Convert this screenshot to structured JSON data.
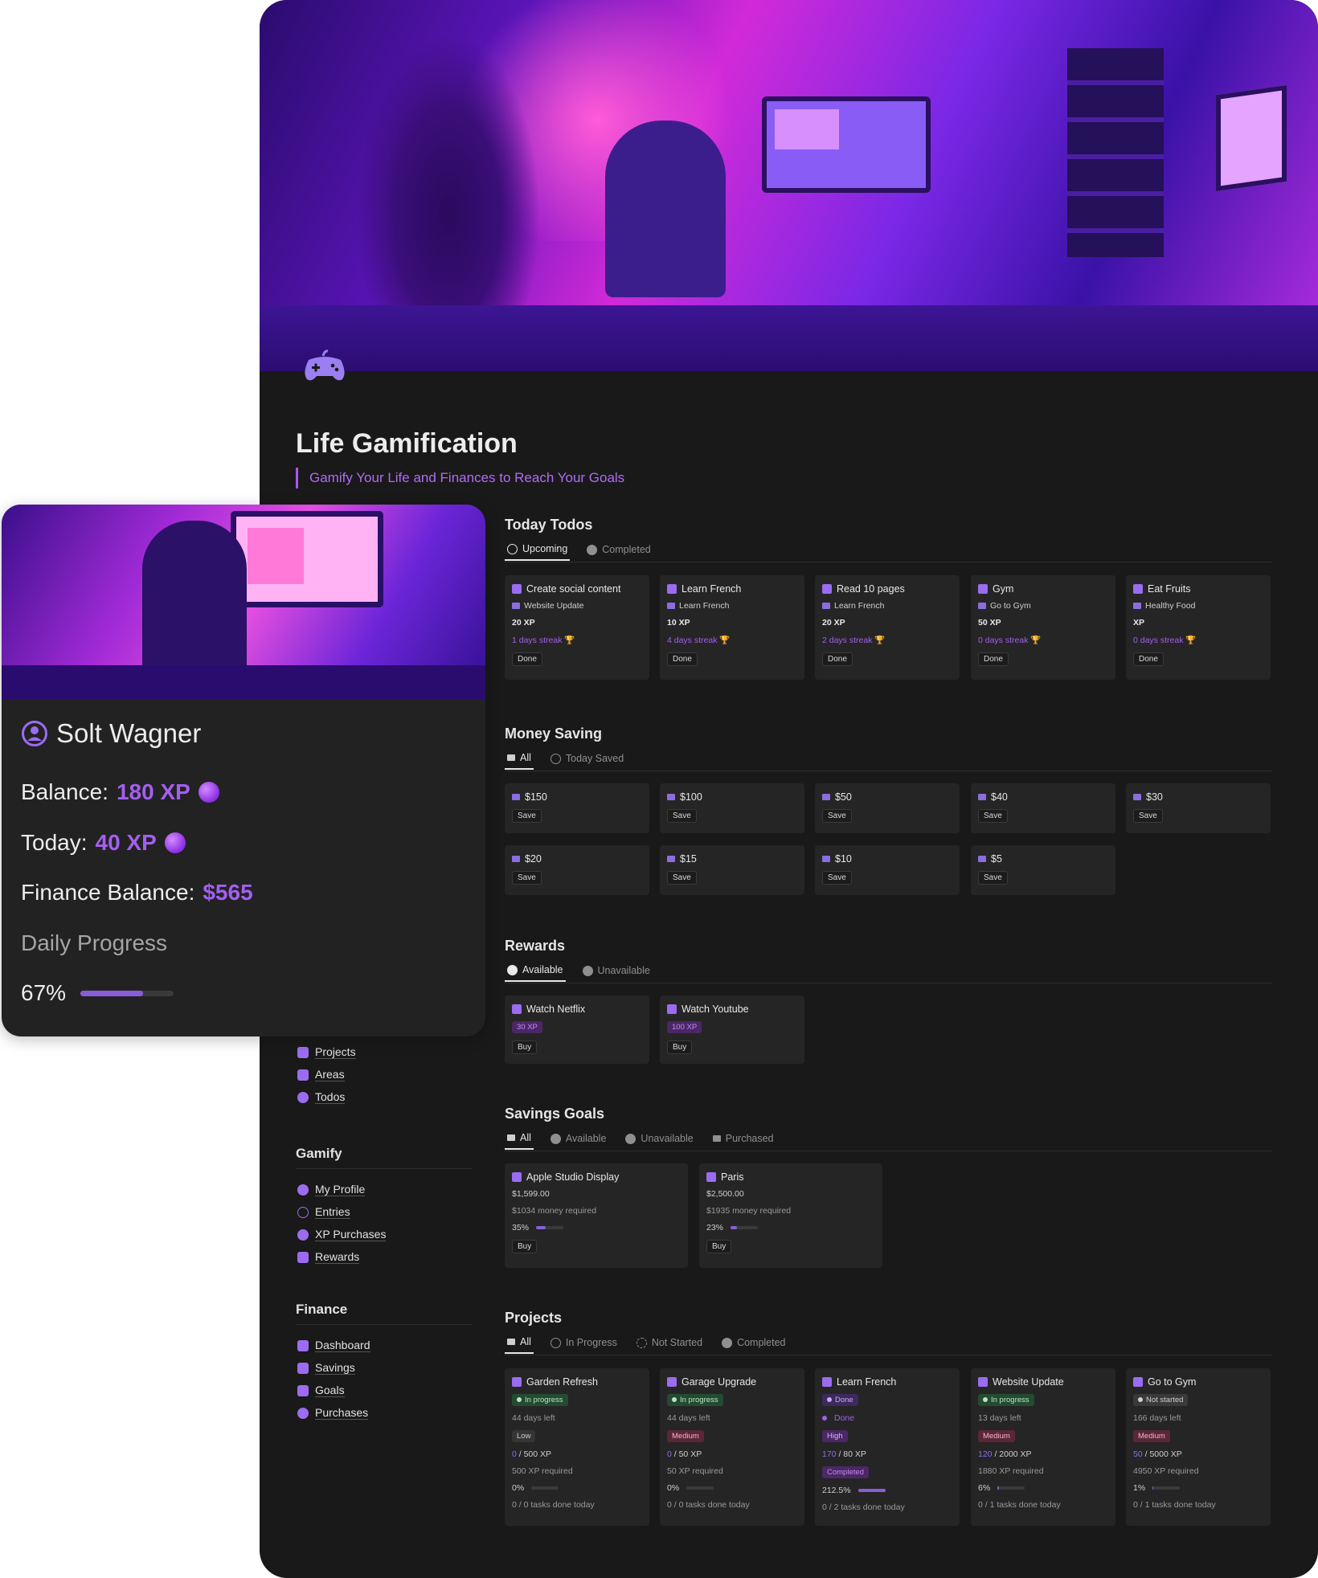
{
  "page": {
    "title": "Life Gamification",
    "subtitle": "Gamify Your Life and Finances to Reach Your Goals",
    "icon": "gamepad-icon"
  },
  "profile": {
    "name": "Solt Wagner",
    "balance_label": "Balance:",
    "balance_value": "180 XP",
    "today_label": "Today:",
    "today_value": "40 XP",
    "finance_label": "Finance Balance:",
    "finance_value": "$565",
    "daily_label": "Daily Progress",
    "daily_value": "67%",
    "daily_fraction": 0.67
  },
  "todos": {
    "title": "Today Todos",
    "tabs": [
      "Upcoming",
      "Completed"
    ],
    "items": [
      {
        "name": "Create social content",
        "project": "Website Update",
        "xp": "20 XP",
        "streak": "1 days streak 🏆",
        "button": "Done"
      },
      {
        "name": "Learn French",
        "project": "Learn French",
        "xp": "10 XP",
        "streak": "4 days streak 🏆",
        "button": "Done"
      },
      {
        "name": "Read 10 pages",
        "project": "Learn French",
        "xp": "20 XP",
        "streak": "2 days streak 🏆",
        "button": "Done"
      },
      {
        "name": "Gym",
        "project": "Go to Gym",
        "xp": "50 XP",
        "streak": "0 days streak 🏆",
        "button": "Done"
      },
      {
        "name": "Eat Fruits",
        "project": "Healthy Food",
        "xp": "XP",
        "streak": "0 days streak 🏆",
        "button": "Done"
      }
    ]
  },
  "saving": {
    "title": "Money Saving",
    "tabs": [
      "All",
      "Today Saved"
    ],
    "items": [
      {
        "amount": "$150",
        "button": "Save"
      },
      {
        "amount": "$100",
        "button": "Save"
      },
      {
        "amount": "$50",
        "button": "Save"
      },
      {
        "amount": "$40",
        "button": "Save"
      },
      {
        "amount": "$30",
        "button": "Save"
      },
      {
        "amount": "$20",
        "button": "Save"
      },
      {
        "amount": "$15",
        "button": "Save"
      },
      {
        "amount": "$10",
        "button": "Save"
      },
      {
        "amount": "$5",
        "button": "Save"
      }
    ]
  },
  "rewards": {
    "title": "Rewards",
    "tabs": [
      "Available",
      "Unavailable"
    ],
    "items": [
      {
        "name": "Watch Netflix",
        "xp": "30 XP",
        "button": "Buy"
      },
      {
        "name": "Watch Youtube",
        "xp": "100 XP",
        "button": "Buy"
      }
    ]
  },
  "goals": {
    "title": "Savings Goals",
    "tabs": [
      "All",
      "Available",
      "Unavailable",
      "Purchased"
    ],
    "items": [
      {
        "name": "Apple Studio Display",
        "price": "$1,599.00",
        "required": "$1034 money required",
        "pct": "35%",
        "fraction": 0.35,
        "button": "Buy"
      },
      {
        "name": "Paris",
        "price": "$2,500.00",
        "required": "$1935 money required",
        "pct": "23%",
        "fraction": 0.23,
        "button": "Buy"
      }
    ]
  },
  "projects": {
    "title": "Projects",
    "tabs": [
      "All",
      "In Progress",
      "Not Started",
      "Completed"
    ],
    "items": [
      {
        "name": "Garden Refresh",
        "status": "In progress",
        "days": "44 days left",
        "priority": "Low",
        "xp_cur": "0",
        "xp_total": " / 500 XP",
        "xp_req": "500 XP required",
        "pct": "0%",
        "fraction": 0.0,
        "tasks": "0 / 0 tasks done today"
      },
      {
        "name": "Garage Upgrade",
        "status": "In progress",
        "days": "44 days left",
        "priority": "Medium",
        "xp_cur": "0",
        "xp_total": " / 50 XP",
        "xp_req": "50 XP required",
        "pct": "0%",
        "fraction": 0.0,
        "tasks": "0 / 0 tasks done today"
      },
      {
        "name": "Learn French",
        "status": "Done",
        "days": "Done",
        "priority": "High",
        "xp_cur": "170",
        "xp_total": " / 80 XP",
        "xp_req": "Completed",
        "pct": "212.5%",
        "fraction": 1.0,
        "tasks": "0 / 2 tasks done today"
      },
      {
        "name": "Website Update",
        "status": "In progress",
        "days": "13 days left",
        "priority": "Medium",
        "xp_cur": "120",
        "xp_total": " / 2000 XP",
        "xp_req": "1880 XP required",
        "pct": "6%",
        "fraction": 0.06,
        "tasks": "0 / 1 tasks done today"
      },
      {
        "name": "Go to Gym",
        "status": "Not started",
        "days": "166 days left",
        "priority": "Medium",
        "xp_cur": "50",
        "xp_total": " / 5000 XP",
        "xp_req": "4950 XP required",
        "pct": "1%",
        "fraction": 0.01,
        "tasks": "0 / 1 tasks done today"
      }
    ]
  },
  "nav": {
    "top": [
      "Projects",
      "Areas",
      "Todos"
    ],
    "gamify_title": "Gamify",
    "gamify": [
      "My Profile",
      "Entries",
      "XP Purchases",
      "Rewards"
    ],
    "finance_title": "Finance",
    "finance": [
      "Dashboard",
      "Savings",
      "Goals",
      "Purchases"
    ]
  },
  "colors": {
    "accent": "#a35ff0",
    "background": "#191919",
    "card": "#252525"
  }
}
